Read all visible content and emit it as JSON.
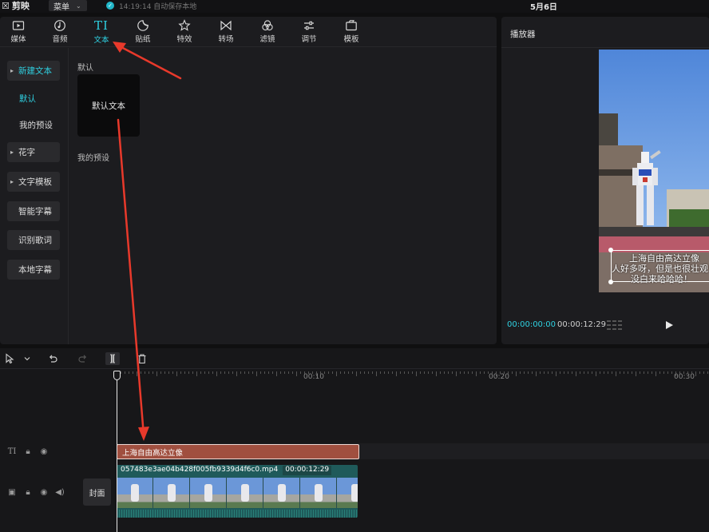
{
  "app": {
    "name": "剪映",
    "menu_label": "菜单",
    "save_status": "14:19:14 自动保存本地",
    "doc_title": "5月6日"
  },
  "toolbar": {
    "tabs": [
      {
        "label": "媒体",
        "icon": "media-icon"
      },
      {
        "label": "音频",
        "icon": "audio-icon"
      },
      {
        "label": "文本",
        "icon": "text-icon",
        "active": true
      },
      {
        "label": "贴纸",
        "icon": "sticker-icon"
      },
      {
        "label": "特效",
        "icon": "effects-icon"
      },
      {
        "label": "转场",
        "icon": "transition-icon"
      },
      {
        "label": "滤镜",
        "icon": "filter-icon"
      },
      {
        "label": "调节",
        "icon": "adjust-icon"
      },
      {
        "label": "模板",
        "icon": "template-icon"
      }
    ]
  },
  "subnav": {
    "new_text": "新建文本",
    "default": "默认",
    "my_presets": "我的预设",
    "fancy_text": "花字",
    "text_templates": "文字模板",
    "smart_captions": "智能字幕",
    "lyrics": "识别歌词",
    "local_captions": "本地字幕"
  },
  "content": {
    "default_label": "默认",
    "default_card": "默认文本",
    "my_presets_label": "我的预设"
  },
  "player": {
    "title": "播放器",
    "subtitle_lines": [
      "上海自由高达立像",
      "人好多呀，但是也很壮观",
      "没白来哈哈哈！"
    ],
    "current_time": "00:00:00:00",
    "total_time": "00:00:12:29"
  },
  "timeline": {
    "ruler": [
      "00:10",
      "00:20",
      "00:30"
    ],
    "text_clip": "上海自由高达立像",
    "video_clip_name": "057483e3ae04b428f005fb9339d4f6c0.mp4",
    "video_clip_duration": "00:00:12:29",
    "cover_label": "封面",
    "text_track_icon": "TI"
  },
  "colors": {
    "accent": "#2fd1e2",
    "text_clip": "#a04f3f",
    "video_clip": "#1f5a5a",
    "annotation_arrow": "#e8392b"
  }
}
